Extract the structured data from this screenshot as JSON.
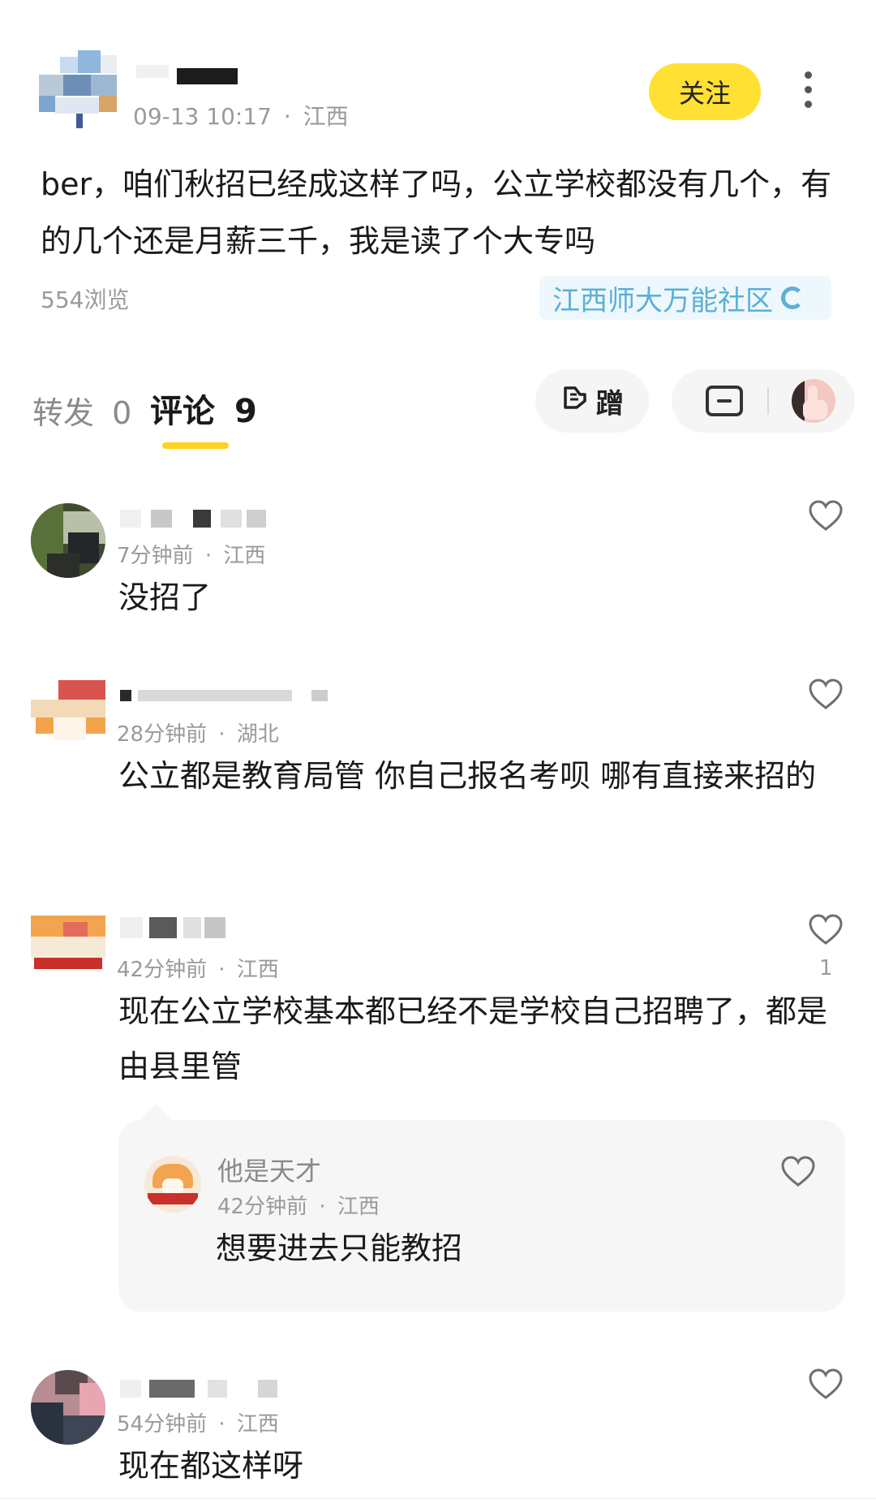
{
  "post": {
    "author_name": "",
    "timestamp": "09-13 10:17",
    "separator": "·",
    "location": "江西",
    "follow_label": "关注",
    "text": "ber，咱们秋招已经成这样了吗，公立学校都没有几个，有的几个还是月薪三千，我是读了个大专吗",
    "views": "554浏览",
    "community": "江西师大万能社区"
  },
  "tabs": {
    "forward_label": "转发",
    "forward_count": "0",
    "comments_label": "评论",
    "comments_count": "9"
  },
  "actions": {
    "ceng_label": "蹭",
    "ceng_icon": "hand-icon",
    "chat_icon": "comment-icon"
  },
  "comments": [
    {
      "time": "7分钟前",
      "location": "江西",
      "text": "没招了",
      "likes": ""
    },
    {
      "time": "28分钟前",
      "location": "湖北",
      "text": "公立都是教育局管 你自己报名考呗 哪有直接来招的",
      "likes": ""
    },
    {
      "time": "42分钟前",
      "location": "江西",
      "text": "现在公立学校基本都已经不是学校自己招聘了，都是由县里管",
      "likes": "1"
    },
    {
      "time": "54分钟前",
      "location": "江西",
      "text": "现在都这样呀",
      "likes": ""
    }
  ],
  "reply": {
    "author": "他是天才",
    "time": "42分钟前",
    "location": "江西",
    "text": "想要进去只能教招"
  },
  "colors": {
    "accent_yellow": "#ffe033",
    "community_blue": "#5ab0d6",
    "meta_gray": "#9a9a9a"
  }
}
